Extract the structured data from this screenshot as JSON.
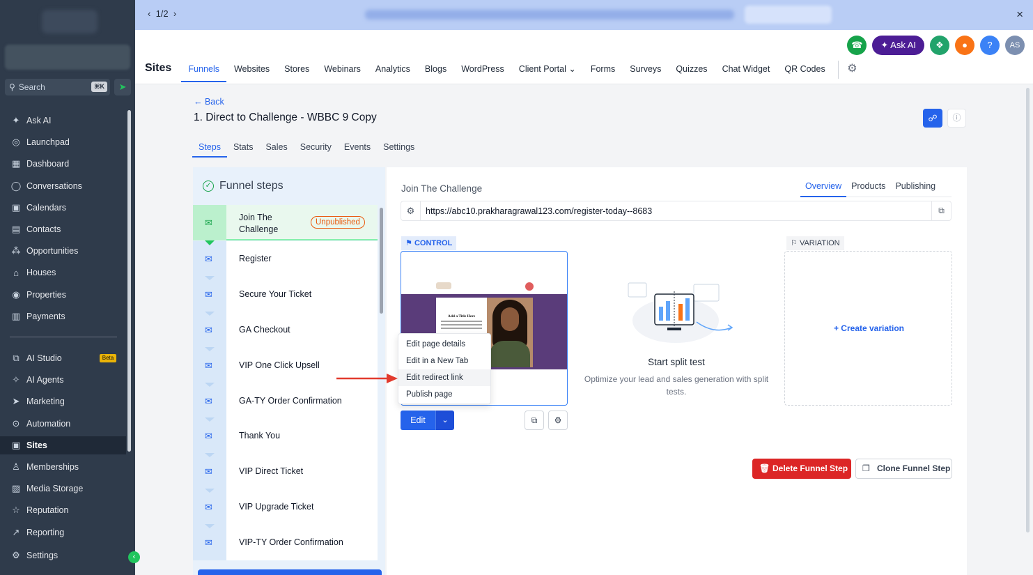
{
  "banner": {
    "pager": "1/2",
    "close": "×"
  },
  "sidebar": {
    "search_placeholder": "Search",
    "search_shortcut": "⌘K",
    "collapse_icon": "‹",
    "nav_top": [
      {
        "label": "Ask AI",
        "icon": "sparkle-icon",
        "glyph": "✦"
      },
      {
        "label": "Launchpad",
        "icon": "rocket-icon",
        "glyph": "◎"
      },
      {
        "label": "Dashboard",
        "icon": "grid-icon",
        "glyph": "▦"
      },
      {
        "label": "Conversations",
        "icon": "chat-icon",
        "glyph": "◯"
      },
      {
        "label": "Calendars",
        "icon": "calendar-icon",
        "glyph": "▣"
      },
      {
        "label": "Contacts",
        "icon": "contacts-icon",
        "glyph": "▤"
      },
      {
        "label": "Opportunities",
        "icon": "opportunities-icon",
        "glyph": "⁂"
      },
      {
        "label": "Houses",
        "icon": "house-icon",
        "glyph": "⌂"
      },
      {
        "label": "Properties",
        "icon": "properties-icon",
        "glyph": "◉"
      },
      {
        "label": "Payments",
        "icon": "payments-icon",
        "glyph": "▥"
      }
    ],
    "nav_bottom": [
      {
        "label": "AI Studio",
        "icon": "ai-studio-icon",
        "glyph": "⧉",
        "badge": "Beta"
      },
      {
        "label": "AI Agents",
        "icon": "ai-agents-icon",
        "glyph": "✧"
      },
      {
        "label": "Marketing",
        "icon": "send-icon",
        "glyph": "➤"
      },
      {
        "label": "Automation",
        "icon": "automation-icon",
        "glyph": "⊙"
      },
      {
        "label": "Sites",
        "icon": "sites-icon",
        "glyph": "▣",
        "active": true
      },
      {
        "label": "Memberships",
        "icon": "memberships-icon",
        "glyph": "♙"
      },
      {
        "label": "Media Storage",
        "icon": "media-icon",
        "glyph": "▨"
      },
      {
        "label": "Reputation",
        "icon": "star-icon",
        "glyph": "☆"
      },
      {
        "label": "Reporting",
        "icon": "reporting-icon",
        "glyph": "↗"
      }
    ],
    "settings": {
      "label": "Settings",
      "glyph": "⚙"
    }
  },
  "header": {
    "section_title": "Sites",
    "ask_ai": "✦ Ask AI",
    "avatar": "AS",
    "help": "?",
    "tabs": [
      {
        "label": "Funnels",
        "active": true
      },
      {
        "label": "Websites"
      },
      {
        "label": "Stores"
      },
      {
        "label": "Webinars"
      },
      {
        "label": "Analytics"
      },
      {
        "label": "Blogs"
      },
      {
        "label": "WordPress"
      },
      {
        "label": "Client Portal ⌄"
      },
      {
        "label": "Forms"
      },
      {
        "label": "Surveys"
      },
      {
        "label": "Quizzes"
      },
      {
        "label": "Chat Widget"
      },
      {
        "label": "QR Codes"
      }
    ]
  },
  "funnel": {
    "back": "← Back",
    "title": "1. Direct to Challenge - WBBC 9 Copy",
    "tabs": [
      {
        "label": "Steps",
        "active": true
      },
      {
        "label": "Stats"
      },
      {
        "label": "Sales"
      },
      {
        "label": "Security"
      },
      {
        "label": "Events"
      },
      {
        "label": "Settings"
      }
    ]
  },
  "steps": {
    "heading": "Funnel steps",
    "items": [
      {
        "name": "Join The\nChallenge",
        "status": "Unpublished",
        "active": true
      },
      {
        "name": "Register"
      },
      {
        "name": "Secure Your Ticket"
      },
      {
        "name": "GA Checkout"
      },
      {
        "name": "VIP One Click Upsell"
      },
      {
        "name": "GA-TY Order Confirmation"
      },
      {
        "name": "Thank You"
      },
      {
        "name": "VIP Direct Ticket"
      },
      {
        "name": "VIP Upgrade Ticket"
      },
      {
        "name": "VIP-TY Order Confirmation"
      }
    ]
  },
  "detail": {
    "title": "Join The Challenge",
    "tabs": [
      {
        "label": "Overview",
        "active": true
      },
      {
        "label": "Products"
      },
      {
        "label": "Publishing"
      }
    ],
    "url": "https://abc10.prakharagrawal123.com/register-today--8683",
    "control_label": "CONTROL",
    "variation_label": "VARIATION",
    "preview_card_title": "Add a Title Here",
    "menu": [
      {
        "label": "Edit page details"
      },
      {
        "label": "Edit in a New Tab"
      },
      {
        "label": "Edit redirect link",
        "hover": true
      },
      {
        "label": "Publish page"
      }
    ],
    "edit_label": "Edit",
    "split_title": "Start split test",
    "split_sub": "Optimize your lead and sales generation with split tests.",
    "create_variation": "+ Create variation",
    "delete_label": "Delete Funnel Step",
    "clone_label": "Clone Funnel Step"
  },
  "colors": {
    "accent": "#2563eb",
    "sidebar_bg": "#2f3b4b",
    "danger": "#dc2626",
    "unpublished": "#ea580c",
    "active_step": "#bbf0cd"
  }
}
